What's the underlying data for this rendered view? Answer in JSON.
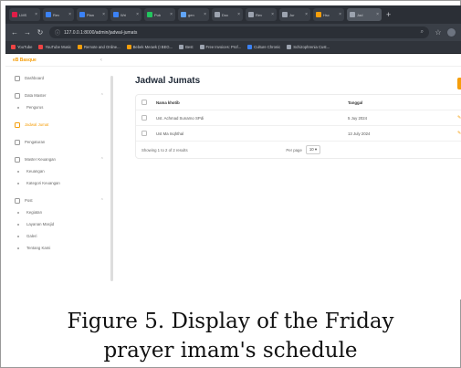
{
  "browser": {
    "tabs": [
      {
        "label": "LMS",
        "color": "#e11d48"
      },
      {
        "label": "Rev",
        "color": "#3b82f6"
      },
      {
        "label": "Plan",
        "color": "#3b82f6"
      },
      {
        "label": "Wri",
        "color": "#3b82f6"
      },
      {
        "label": "Pub",
        "color": "#22c55e"
      },
      {
        "label": "gen",
        "color": "#60a5fa"
      },
      {
        "label": "Doc",
        "color": "#9ca3af"
      },
      {
        "label": "Rev",
        "color": "#9ca3af"
      },
      {
        "label": "Jur",
        "color": "#9ca3af"
      },
      {
        "label": "Hsc",
        "color": "#f59e0b"
      },
      {
        "label": "Jad",
        "color": "#9ca3af"
      }
    ],
    "url": "127.0.0.1:8000/admin/jadwal-jumats",
    "bookmarks": [
      {
        "label": "YouTube",
        "color": "#ef4444"
      },
      {
        "label": "YouTube Music",
        "color": "#ef4444"
      },
      {
        "label": "Remote and Online...",
        "color": "#f59e0b"
      },
      {
        "label": "Bebek Meowk (I BEG...",
        "color": "#f59e0b"
      },
      {
        "label": "Best",
        "color": "#9ca3af"
      },
      {
        "label": "Free Invoices: Prof...",
        "color": "#9ca3af"
      },
      {
        "label": "Culture Chronic",
        "color": "#3b82f6"
      },
      {
        "label": "Schizophrenia Cust...",
        "color": "#9ca3af"
      }
    ]
  },
  "app": {
    "brand": "eB Basque",
    "sidebar": [
      {
        "label": "Dashboard",
        "type": "item"
      },
      {
        "type": "gap"
      },
      {
        "label": "Data Master",
        "type": "group"
      },
      {
        "label": "Pengurus",
        "type": "sub"
      },
      {
        "type": "gap"
      },
      {
        "label": "Jadwal Jumat",
        "type": "item",
        "active": true
      },
      {
        "type": "gap"
      },
      {
        "label": "Pengaturan",
        "type": "item"
      },
      {
        "type": "gap"
      },
      {
        "label": "Master Keuangan",
        "type": "group"
      },
      {
        "label": "Keuangan",
        "type": "sub"
      },
      {
        "label": "Kategori Keuangan",
        "type": "sub"
      },
      {
        "type": "gap"
      },
      {
        "label": "Post",
        "type": "group"
      },
      {
        "label": "Kegiatan",
        "type": "sub"
      },
      {
        "label": "Layanan Masjid",
        "type": "sub"
      },
      {
        "label": "Galeri",
        "type": "sub"
      },
      {
        "label": "Tentang Kami",
        "type": "sub"
      }
    ],
    "page_title": "Jadwal Jumats",
    "table": {
      "headers": [
        "Nama khotib",
        "Tanggal"
      ],
      "rows": [
        {
          "name": "Ust. Achmad Sunarno SPdi",
          "date": "5 Juy 2024"
        },
        {
          "name": "Ust Ma Inqhthal",
          "date": "13 July 2024"
        }
      ],
      "footer": {
        "showing": "Showing 1 to 2 of 2 results",
        "per_page_label": "Per page",
        "per_page_value": "10"
      }
    }
  },
  "caption": {
    "line1": "Figure 5. Display of the Friday",
    "line2": "prayer imam's schedule"
  }
}
